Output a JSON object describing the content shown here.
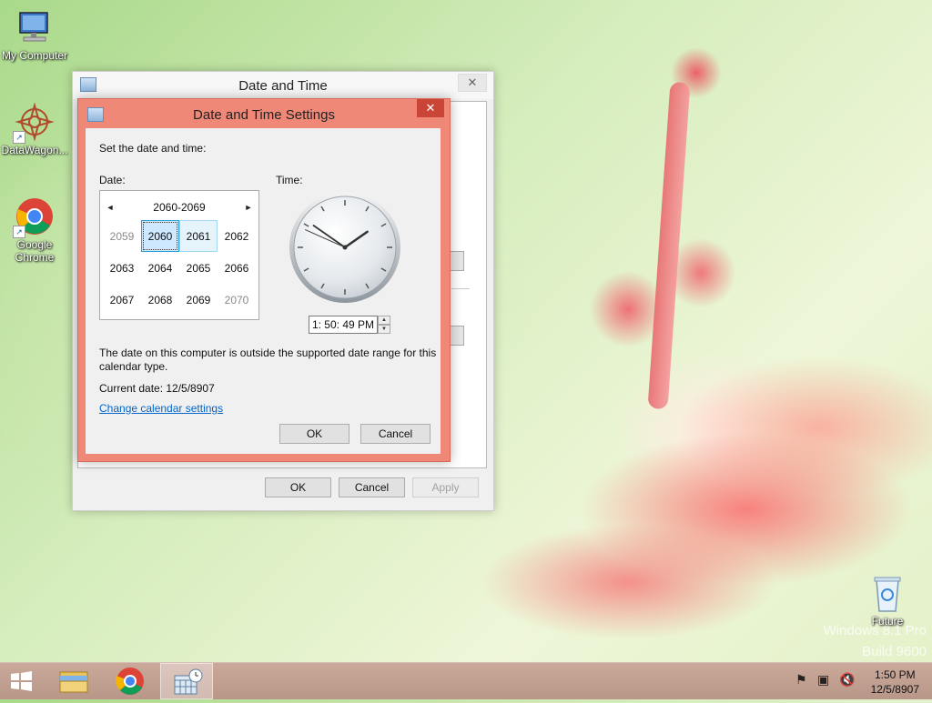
{
  "desktop": {
    "icons": [
      {
        "label": "My Computer",
        "icon": "monitor-icon"
      },
      {
        "label": "DataWagon...",
        "icon": "datawagon-icon"
      },
      {
        "label": "Google Chrome",
        "icon": "chrome-icon"
      },
      {
        "label": "Future",
        "icon": "recycle-bin-icon"
      }
    ],
    "watermark": [
      "Windows 8.1 Pro",
      "Build 9600"
    ]
  },
  "outer_window": {
    "title": "Date and Time",
    "close": "✕",
    "buttons": {
      "ok": "OK",
      "cancel": "Cancel",
      "apply": "Apply"
    }
  },
  "dialog": {
    "title": "Date and Time Settings",
    "close": "✕",
    "instruction": "Set the date and time:",
    "date_label": "Date:",
    "time_label": "Time:",
    "calendar": {
      "range": "2060-2069",
      "prev": "◄",
      "next": "►",
      "years": [
        {
          "y": "2059",
          "state": "dim"
        },
        {
          "y": "2060",
          "state": "sel"
        },
        {
          "y": "2061",
          "state": "hot"
        },
        {
          "y": "2062",
          "state": ""
        },
        {
          "y": "2063",
          "state": ""
        },
        {
          "y": "2064",
          "state": ""
        },
        {
          "y": "2065",
          "state": ""
        },
        {
          "y": "2066",
          "state": ""
        },
        {
          "y": "2067",
          "state": ""
        },
        {
          "y": "2068",
          "state": ""
        },
        {
          "y": "2069",
          "state": ""
        },
        {
          "y": "2070",
          "state": "dim"
        }
      ]
    },
    "clock": {
      "hour": 1,
      "minute": 50,
      "second": 49
    },
    "time_value": "1: 50: 49 PM",
    "message": "The date on this computer is outside the supported date range for this calendar type.",
    "current_date": "Current date: 12/5/8907",
    "link": "Change calendar settings",
    "ok": "OK",
    "cancel": "Cancel"
  },
  "taskbar": {
    "apps": [
      "start-icon",
      "file-explorer-icon",
      "chrome-icon",
      "date-time-icon"
    ],
    "active": "date-time-icon",
    "time": "1:50 PM",
    "date": "12/5/8907"
  }
}
